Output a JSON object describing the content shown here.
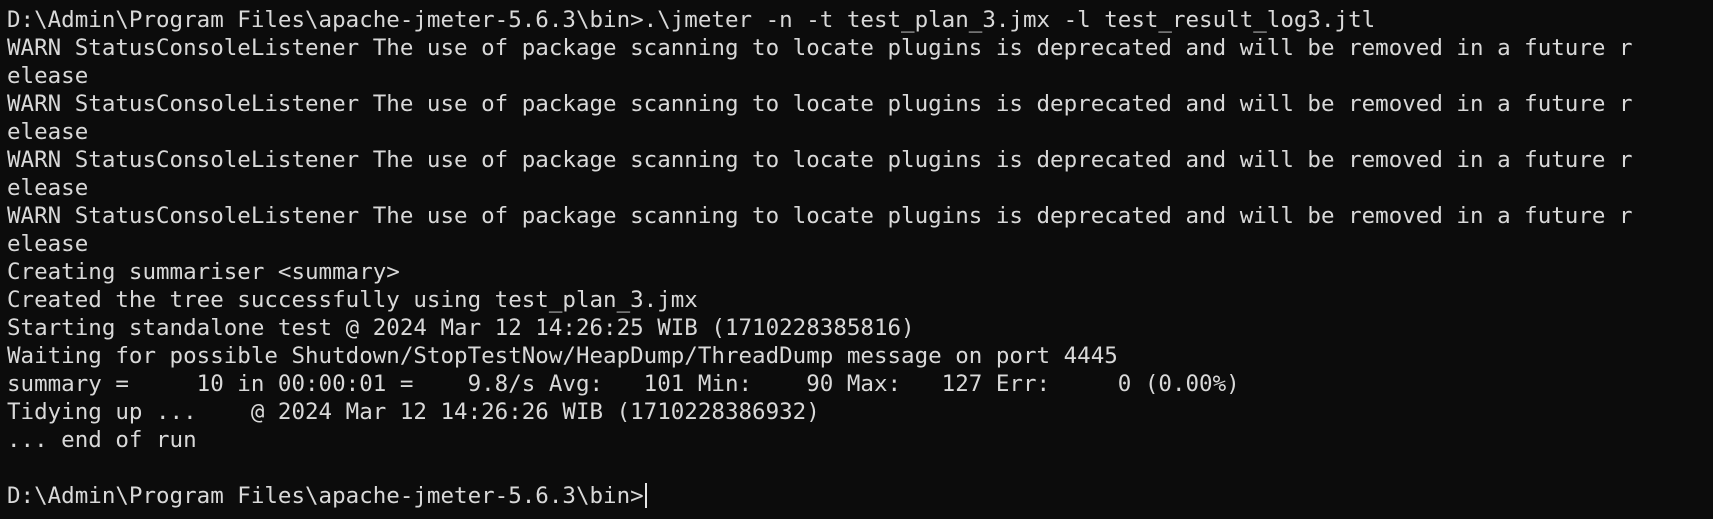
{
  "terminal": {
    "lines": [
      "D:\\Admin\\Program Files\\apache-jmeter-5.6.3\\bin>.\\jmeter -n -t test_plan_3.jmx -l test_result_log3.jtl",
      "WARN StatusConsoleListener The use of package scanning to locate plugins is deprecated and will be removed in a future r",
      "elease",
      "WARN StatusConsoleListener The use of package scanning to locate plugins is deprecated and will be removed in a future r",
      "elease",
      "WARN StatusConsoleListener The use of package scanning to locate plugins is deprecated and will be removed in a future r",
      "elease",
      "WARN StatusConsoleListener The use of package scanning to locate plugins is deprecated and will be removed in a future r",
      "elease",
      "Creating summariser <summary>",
      "Created the tree successfully using test_plan_3.jmx",
      "Starting standalone test @ 2024 Mar 12 14:26:25 WIB (1710228385816)",
      "Waiting for possible Shutdown/StopTestNow/HeapDump/ThreadDump message on port 4445",
      "summary =     10 in 00:00:01 =    9.8/s Avg:   101 Min:    90 Max:   127 Err:     0 (0.00%)",
      "Tidying up ...    @ 2024 Mar 12 14:26:26 WIB (1710228386932)",
      "... end of run",
      ""
    ],
    "prompt": "D:\\Admin\\Program Files\\apache-jmeter-5.6.3\\bin>"
  }
}
